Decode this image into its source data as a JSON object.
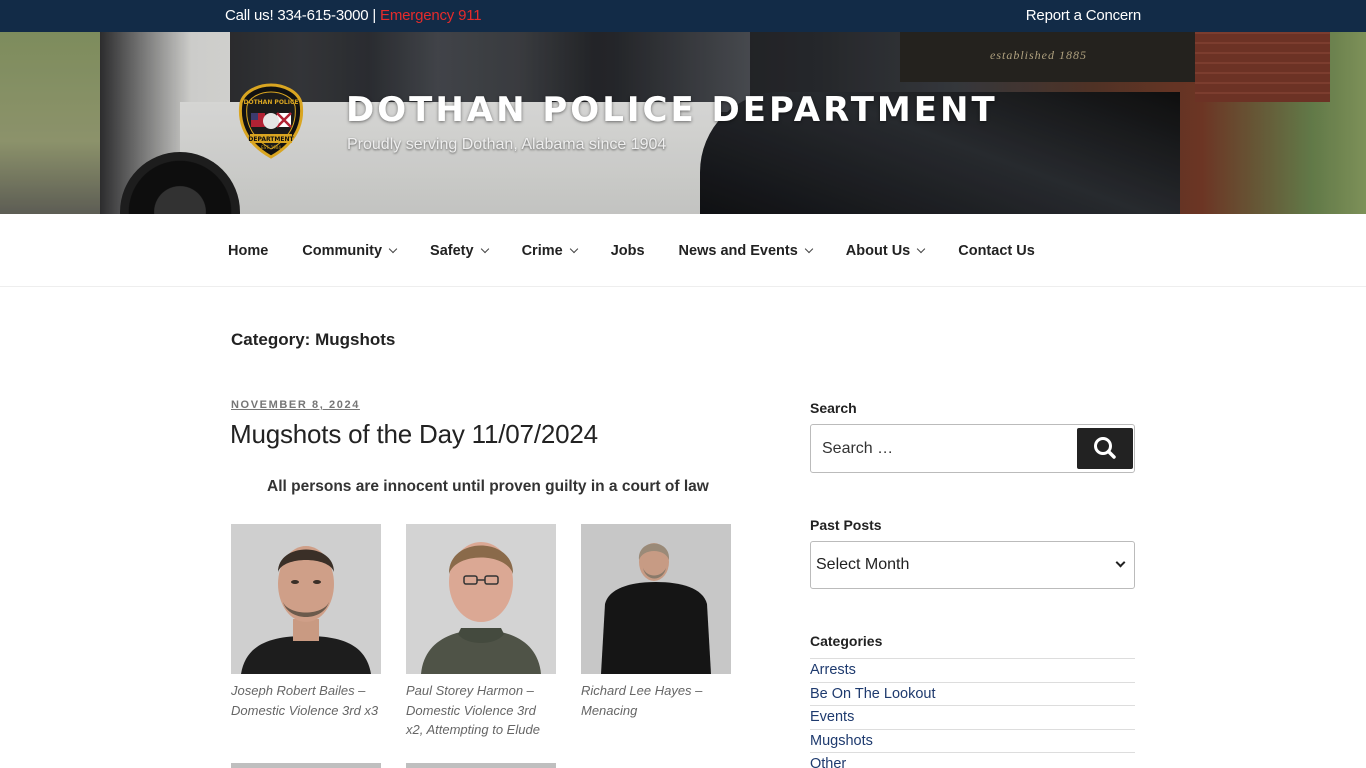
{
  "topbar": {
    "call_text": "Call us! 334-615-3000 | ",
    "emergency": "Emergency 911",
    "report": "Report a Concern"
  },
  "header": {
    "site_title": "DOTHAN POLICE DEPARTMENT",
    "site_description": "Proudly serving Dothan, Alabama since 1904",
    "sign_text": "established 1885",
    "badge_top": "DOTHAN POLICE",
    "badge_bottom": "DEPARTMENT",
    "badge_est": "EST. 1904"
  },
  "nav": {
    "items": [
      {
        "label": "Home",
        "dropdown": false
      },
      {
        "label": "Community",
        "dropdown": true
      },
      {
        "label": "Safety",
        "dropdown": true
      },
      {
        "label": "Crime",
        "dropdown": true
      },
      {
        "label": "Jobs",
        "dropdown": false
      },
      {
        "label": "News and Events",
        "dropdown": true
      },
      {
        "label": "About Us",
        "dropdown": true
      },
      {
        "label": "Contact Us",
        "dropdown": false
      }
    ]
  },
  "page": {
    "title": "Category: Mugshots"
  },
  "post": {
    "date": "NOVEMBER 8, 2024",
    "title": "Mugshots of the Day 11/07/2024",
    "note": "All persons are innocent until proven guilty in a court of law",
    "gallery": [
      {
        "caption": "Joseph Robert Bailes – Domestic Violence 3rd x3"
      },
      {
        "caption": "Paul Storey Harmon – Domestic Violence 3rd x2, Attempting to Elude"
      },
      {
        "caption": "Richard Lee Hayes – Menacing"
      }
    ]
  },
  "sidebar": {
    "search_title": "Search",
    "search_placeholder": "Search …",
    "past_posts_title": "Past Posts",
    "month_select": "Select Month",
    "categories_title": "Categories",
    "categories": [
      "Arrests",
      "Be On The Lookout",
      "Events",
      "Mugshots",
      "Other"
    ]
  },
  "colors": {
    "topbar_bg": "#122b47",
    "emergency": "#e52b2b",
    "link": "#1e3a6e"
  }
}
